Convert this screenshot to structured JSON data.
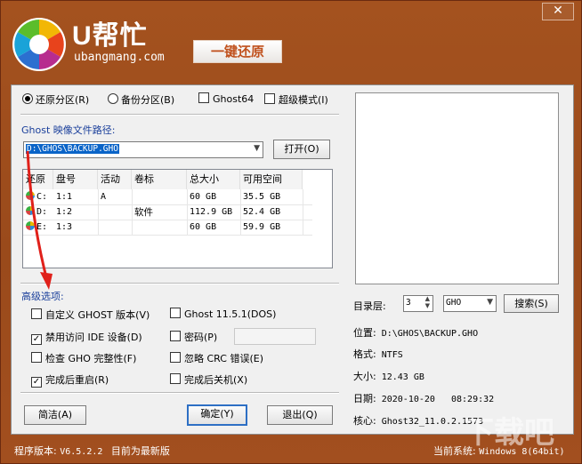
{
  "window": {
    "close_label": "✕",
    "brand": "U帮忙",
    "domain": "ubangmang.com",
    "badge": "一键还原",
    "watermark": "下载吧"
  },
  "mode": {
    "restore": "还原分区(R)",
    "backup": "备份分区(B)",
    "ghost64": "Ghost64",
    "super": "超级模式(I)"
  },
  "image_path": {
    "label": "Ghost 映像文件路径:",
    "value": "D:\\GHOS\\BACKUP.GHO",
    "open_button": "打开(O)"
  },
  "partitions": {
    "headers": [
      "还原",
      "盘号",
      "活动",
      "卷标",
      "总大小",
      "可用空间"
    ],
    "rows": [
      {
        "drive": "C:",
        "num": "1:1",
        "active": "A",
        "label": "",
        "size": "60 GB",
        "free": "35.5 GB"
      },
      {
        "drive": "D:",
        "num": "1:2",
        "active": "",
        "label": "软件",
        "size": "112.9 GB",
        "free": "52.4 GB"
      },
      {
        "drive": "E:",
        "num": "1:3",
        "active": "",
        "label": "",
        "size": "60 GB",
        "free": "59.9 GB"
      }
    ]
  },
  "advanced": {
    "title": "高级选项:",
    "custom_ghost": "自定义 GHOST 版本(V)",
    "ghost_ver": "Ghost 11.5.1(DOS)",
    "disable_ide": "禁用访问 IDE 设备(D)",
    "password": "密码(P)",
    "check_gho": "检查 GHO 完整性(F)",
    "ignore_crc": "忽略 CRC 错误(E)",
    "reboot": "完成后重启(R)",
    "shutdown": "完成后关机(X)"
  },
  "checks": {
    "custom_ghost": false,
    "ghost_ver": false,
    "disable_ide": true,
    "password": false,
    "check_gho": false,
    "ignore_crc": false,
    "reboot": true,
    "shutdown": false
  },
  "buttons": {
    "simple": "简洁(A)",
    "ok": "确定(Y)",
    "quit": "退出(Q)",
    "search": "搜索(S)"
  },
  "directory": {
    "label": "目录层:",
    "depth": "3",
    "ext": "GHO"
  },
  "file_info": {
    "location_label": "位置:",
    "location": "D:\\GHOS\\BACKUP.GHO",
    "format_label": "格式:",
    "format": "NTFS",
    "size_label": "大小:",
    "size": "12.43 GB",
    "date_label": "日期:",
    "date": "2020-10-20   08:29:32",
    "core_label": "核心:",
    "core": "Ghost32_11.0.2.1573"
  },
  "footer": {
    "version_label": "程序版本:",
    "version": "V6.5.2.2",
    "latest": "目前为最新版",
    "system_label": "当前系统:",
    "system": "Windows 8(64bit)"
  },
  "colors": {
    "frame": "#9a4a1b",
    "accent": "#c0501c",
    "arrow": "#e0201a",
    "selection": "#0a64c8"
  }
}
